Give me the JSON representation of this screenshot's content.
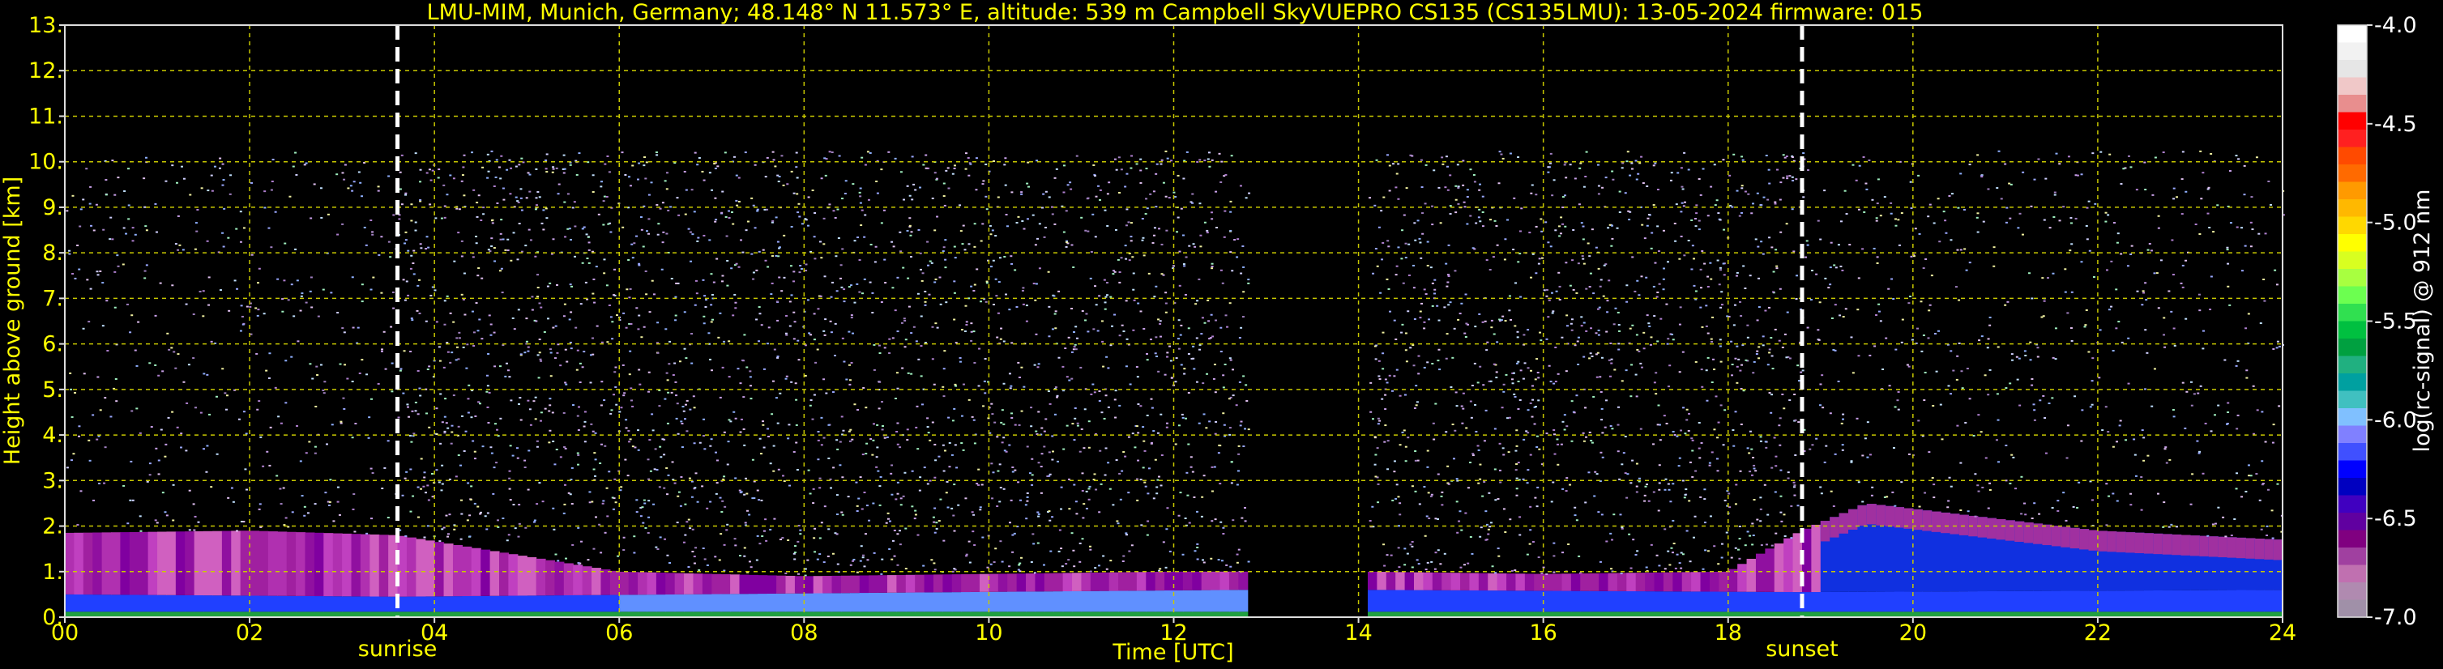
{
  "chart_data": {
    "type": "heatmap",
    "title": "LMU-MIM, Munich, Germany; 48.148° N 11.573° E, altitude: 539 m    Campbell SkyVUEPRO CS135 (CS135LMU): 13-05-2024    firmware: 015",
    "xlabel": "Time [UTC]",
    "ylabel": "Height above ground [km]",
    "xlim": [
      0,
      24
    ],
    "ylim": [
      0,
      13
    ],
    "x_ticks": [
      "00",
      "02",
      "04",
      "06",
      "08",
      "10",
      "12",
      "14",
      "16",
      "18",
      "20",
      "22",
      "24"
    ],
    "y_ticks": [
      "0.",
      "1.",
      "2.",
      "3.",
      "4.",
      "5.",
      "6.",
      "7.",
      "8.",
      "9.",
      "10.",
      "11.",
      "12.",
      "13."
    ],
    "grid": true,
    "colorbar": {
      "label": "log(rc-signal) @ 912 nm",
      "range": [
        -7.0,
        -4.0
      ],
      "ticks": [
        "-4.0",
        "-4.5",
        "-5.0",
        "-5.5",
        "-6.0",
        "-6.5",
        "-7.0"
      ],
      "colors": [
        "#ffffff",
        "#f2f2f2",
        "#e6e6e6",
        "#f0c8c8",
        "#e88e8e",
        "#ff0000",
        "#ff2020",
        "#ff4a00",
        "#ff6a00",
        "#ff9a00",
        "#ffb800",
        "#ffd800",
        "#ffff00",
        "#d8ff20",
        "#a8ff40",
        "#6cff50",
        "#30e050",
        "#00c040",
        "#00a040",
        "#20b080",
        "#00a0a0",
        "#40c0c0",
        "#80c0ff",
        "#8080ff",
        "#4050ff",
        "#0000ff",
        "#0000c0",
        "#4000c0",
        "#6000a0",
        "#800080",
        "#a040a0",
        "#c070b0",
        "#b08ab0",
        "#a090a8"
      ]
    },
    "events": [
      {
        "label": "sunrise",
        "time_utc": 3.6
      },
      {
        "label": "sunset",
        "time_utc": 18.8
      }
    ],
    "no_data_interval_utc": [
      12.75,
      14.05
    ],
    "data_top_km": 10.25,
    "layers": [
      {
        "name": "near-surface",
        "x": [
          0,
          3.6,
          12.75,
          14.05,
          18.8,
          24
        ],
        "top_km": [
          0.5,
          0.45,
          0.6,
          0.6,
          0.55,
          0.6
        ]
      },
      {
        "name": "boundary layer",
        "x": [
          0,
          2,
          3.6,
          6,
          8,
          10,
          12,
          12.75,
          14.05,
          16,
          18,
          18.8,
          19.5,
          22,
          24
        ],
        "top_km": [
          1.85,
          1.9,
          1.8,
          1.0,
          0.9,
          0.95,
          1.0,
          1.0,
          1.0,
          0.95,
          1.0,
          1.9,
          2.5,
          1.9,
          1.7
        ]
      }
    ]
  }
}
